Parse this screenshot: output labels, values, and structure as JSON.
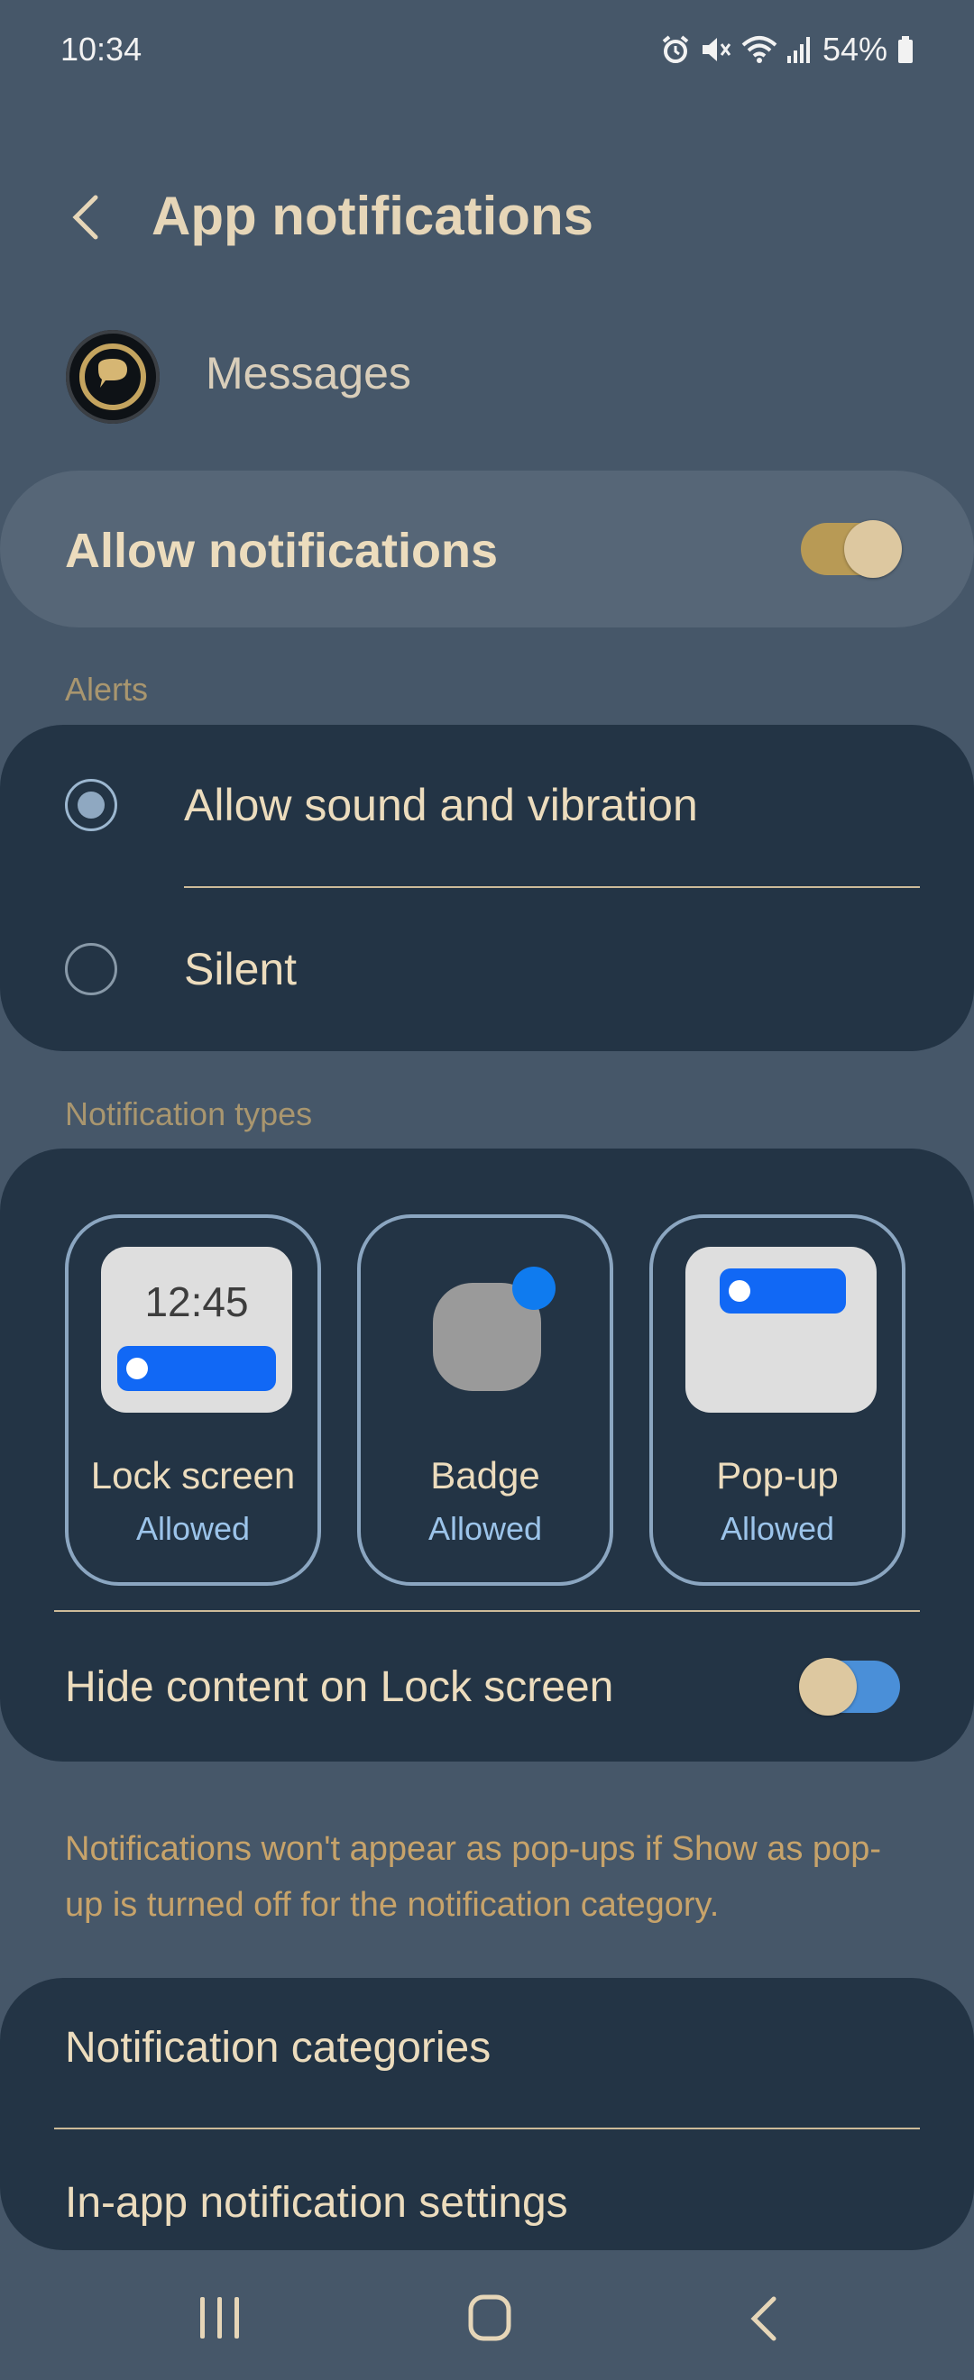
{
  "status_bar": {
    "time": "10:34",
    "battery": "54%",
    "icons": [
      "alarm-icon",
      "mute-icon",
      "wifi-icon",
      "signal-icon",
      "battery-icon"
    ]
  },
  "header": {
    "title": "App notifications",
    "back_icon": "back-arrow-icon"
  },
  "app": {
    "name": "Messages",
    "icon": "messages-app-icon"
  },
  "allow": {
    "label": "Allow notifications",
    "enabled": true
  },
  "alerts": {
    "section_label": "Alerts",
    "options": [
      {
        "label": "Allow sound and vibration",
        "selected": true
      },
      {
        "label": "Silent",
        "selected": false
      }
    ]
  },
  "notification_types": {
    "section_label": "Notification types",
    "types": [
      {
        "title": "Lock screen",
        "status": "Allowed",
        "preview_time": "12:45"
      },
      {
        "title": "Badge",
        "status": "Allowed"
      },
      {
        "title": "Pop-up",
        "status": "Allowed"
      }
    ],
    "hide_content": {
      "label": "Hide content on Lock screen",
      "enabled": true
    }
  },
  "hint": "Notifications won't appear as pop-ups if Show as pop-up is turned off for the notification category.",
  "more": {
    "items": [
      "Notification categories",
      "In-app notification settings"
    ]
  },
  "nav": {
    "icons": [
      "recent-apps-icon",
      "home-icon",
      "back-icon"
    ]
  },
  "colors": {
    "background": "#465769",
    "card": "#233445",
    "accent_toggle": "#b89a55",
    "blue_toggle": "#4a8fd8",
    "hint_text": "#c7a36a"
  }
}
